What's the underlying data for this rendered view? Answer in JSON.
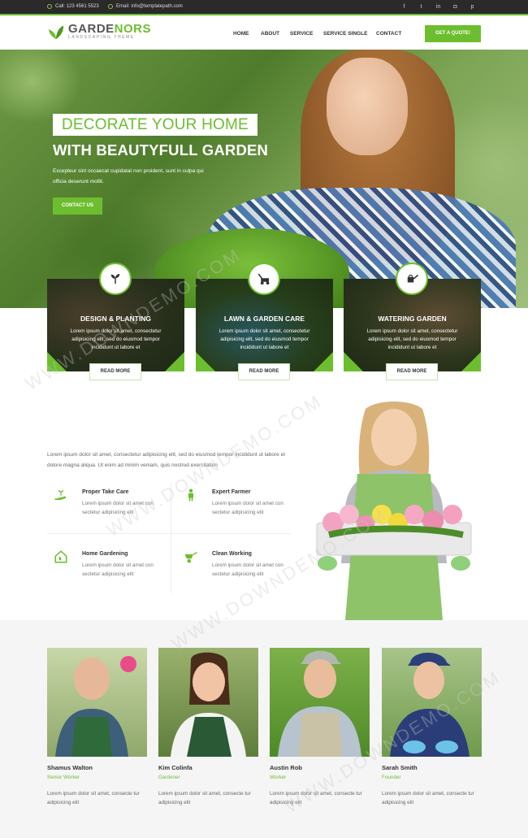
{
  "topbar": {
    "call": "Call: 123 4561 5523",
    "email": "Email: info@templatepath.com",
    "social": [
      "facebook-icon",
      "twitter-icon",
      "linkedin-icon",
      "instagram-icon",
      "pinterest-icon"
    ]
  },
  "header": {
    "logo_part1": "GARDE",
    "logo_part2": "NORS",
    "logo_tag": "Landscaping Theme",
    "nav": [
      "HOME",
      "ABOUT",
      "SERVICE",
      "SERVICE SINGLE",
      "CONTACT"
    ],
    "cta": "GET A QUOTE!"
  },
  "hero": {
    "title1": "DECORATE YOUR HOME",
    "title2": "WITH BEAUTYFULL GARDEN",
    "description": "Excepteur sint occaecat cupidatat non proident, sunt in culpa qui officia deserunt mollit.",
    "button": "CONTACT US"
  },
  "services": [
    {
      "title": "DESIGN & PLANTING",
      "text": "Lorem ipsum dolor sit amet, consectetur adipisicing elit, sed do eiusmod tempor incididunt ut labore et",
      "button": "READ MORE",
      "icon": "sprout-icon"
    },
    {
      "title": "LAWN & GARDEN CARE",
      "text": "Lorem ipsum dolor sit amet, consectetur adipisicing elit, sed do eiusmod tempor incididunt ut labore et",
      "button": "READ MORE",
      "icon": "lawnmower-icon"
    },
    {
      "title": "WATERING GARDEN",
      "text": "Lorem ipsum dolor sit amet, consectetur adipisicing elit, sed do eiusmod tempor incididunt ut labore et",
      "button": "READ MORE",
      "icon": "watering-can-icon"
    }
  ],
  "about": {
    "text": "Lorem ipsum dolor sit amet, consectetur adipisicing elit, sed do eiusmod tempor incididunt ut labore et dolore magna aliqua. Ut enim ad minim veniam, quis nostrud exercitation"
  },
  "features": [
    {
      "title": "Proper Take Care",
      "text": "Lorem ipsum dolor sit amet con sectetur adipisicing elit",
      "icon": "hand-plant-icon"
    },
    {
      "title": "Expert Farmer",
      "text": "Lorem ipsum dolor sit amet con sectetur adipisicing elit",
      "icon": "farmer-icon"
    },
    {
      "title": "Home Gardening",
      "text": "Lorem ipsum dolor sit amet con sectetur adipisicing elit",
      "icon": "home-leaf-icon"
    },
    {
      "title": "Clean Working",
      "text": "Lorem ipsum dolor sit amet con sectetur adipisicing elit",
      "icon": "wheelbarrow-icon"
    }
  ],
  "team": [
    {
      "name": "Shamus Walton",
      "role": "Senior Worker",
      "desc": "Lorem ipsum dolor sit amet, consecte tur adipisicing elit"
    },
    {
      "name": "Kim Colinfa",
      "role": "Gardener",
      "desc": "Lorem ipsum dolor sit amet, consecte tur adipisicing elit"
    },
    {
      "name": "Austin Rob",
      "role": "Worker",
      "desc": "Lorem ipsum dolor sit amet, consecte tur adipisicing elit"
    },
    {
      "name": "Sarah Smith",
      "role": "Founder",
      "desc": "Lorem ipsum dolor sit amet, consecte tur adipisicing elit"
    }
  ],
  "watermark": "WWW.DOWNDEMO.COM",
  "colors": {
    "accent": "#6cbe2e",
    "topbar": "#2a2a2a"
  }
}
